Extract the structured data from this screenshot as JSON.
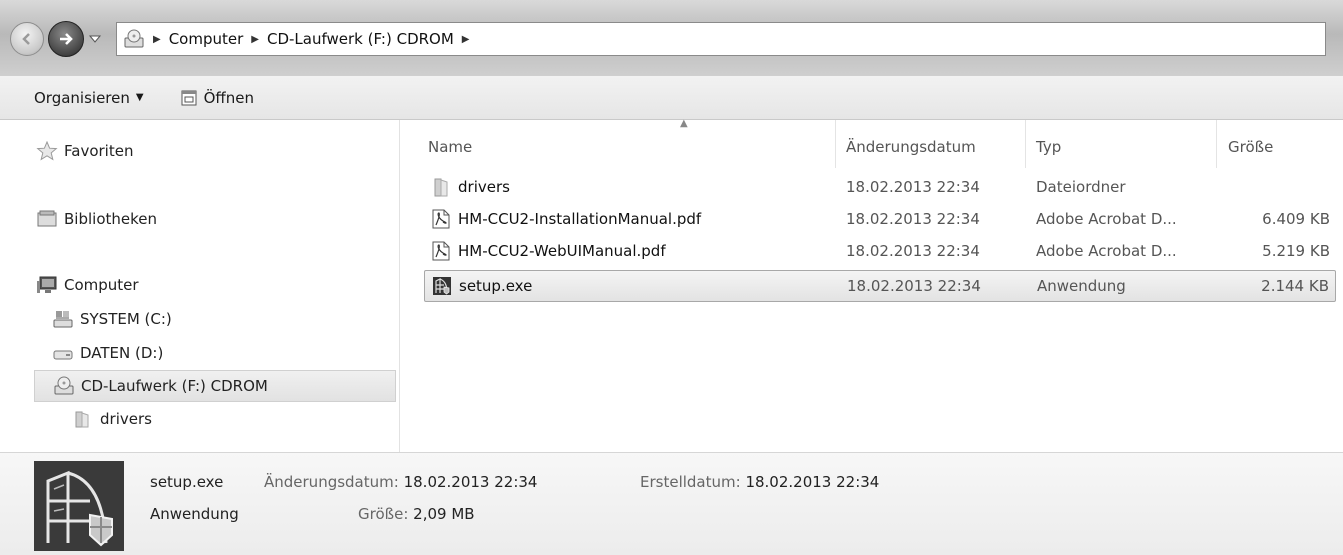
{
  "address": {
    "segments": [
      "Computer",
      "CD-Laufwerk (F:) CDROM"
    ]
  },
  "toolbar": {
    "organize_label": "Organisieren",
    "open_label": "Öffnen"
  },
  "navigation": {
    "favorites": "Favoriten",
    "libraries": "Bibliotheken",
    "computer": "Computer",
    "drive_c": "SYSTEM (C:)",
    "drive_d": "DATEN (D:)",
    "drive_f": "CD-Laufwerk (F:) CDROM",
    "folder_drivers": "drivers"
  },
  "columns": {
    "name": "Name",
    "date": "Änderungsdatum",
    "type": "Typ",
    "size": "Größe"
  },
  "files": [
    {
      "name": "drivers",
      "date": "18.02.2013 22:34",
      "type": "Dateiordner",
      "size": "",
      "icon": "folder-icon"
    },
    {
      "name": "HM-CCU2-InstallationManual.pdf",
      "date": "18.02.2013 22:34",
      "type": "Adobe Acrobat D...",
      "size": "6.409 KB",
      "icon": "pdf-icon"
    },
    {
      "name": "HM-CCU2-WebUIManual.pdf",
      "date": "18.02.2013 22:34",
      "type": "Adobe Acrobat D...",
      "size": "5.219 KB",
      "icon": "pdf-icon"
    },
    {
      "name": "setup.exe",
      "date": "18.02.2013 22:34",
      "type": "Anwendung",
      "size": "2.144 KB",
      "icon": "application-icon"
    }
  ],
  "details": {
    "filename": "setup.exe",
    "filetype": "Anwendung",
    "modified_label": "Änderungsdatum:",
    "modified_value": "18.02.2013 22:34",
    "size_label": "Größe:",
    "size_value": "2,09 MB",
    "created_label": "Erstelldatum:",
    "created_value": "18.02.2013 22:34"
  }
}
